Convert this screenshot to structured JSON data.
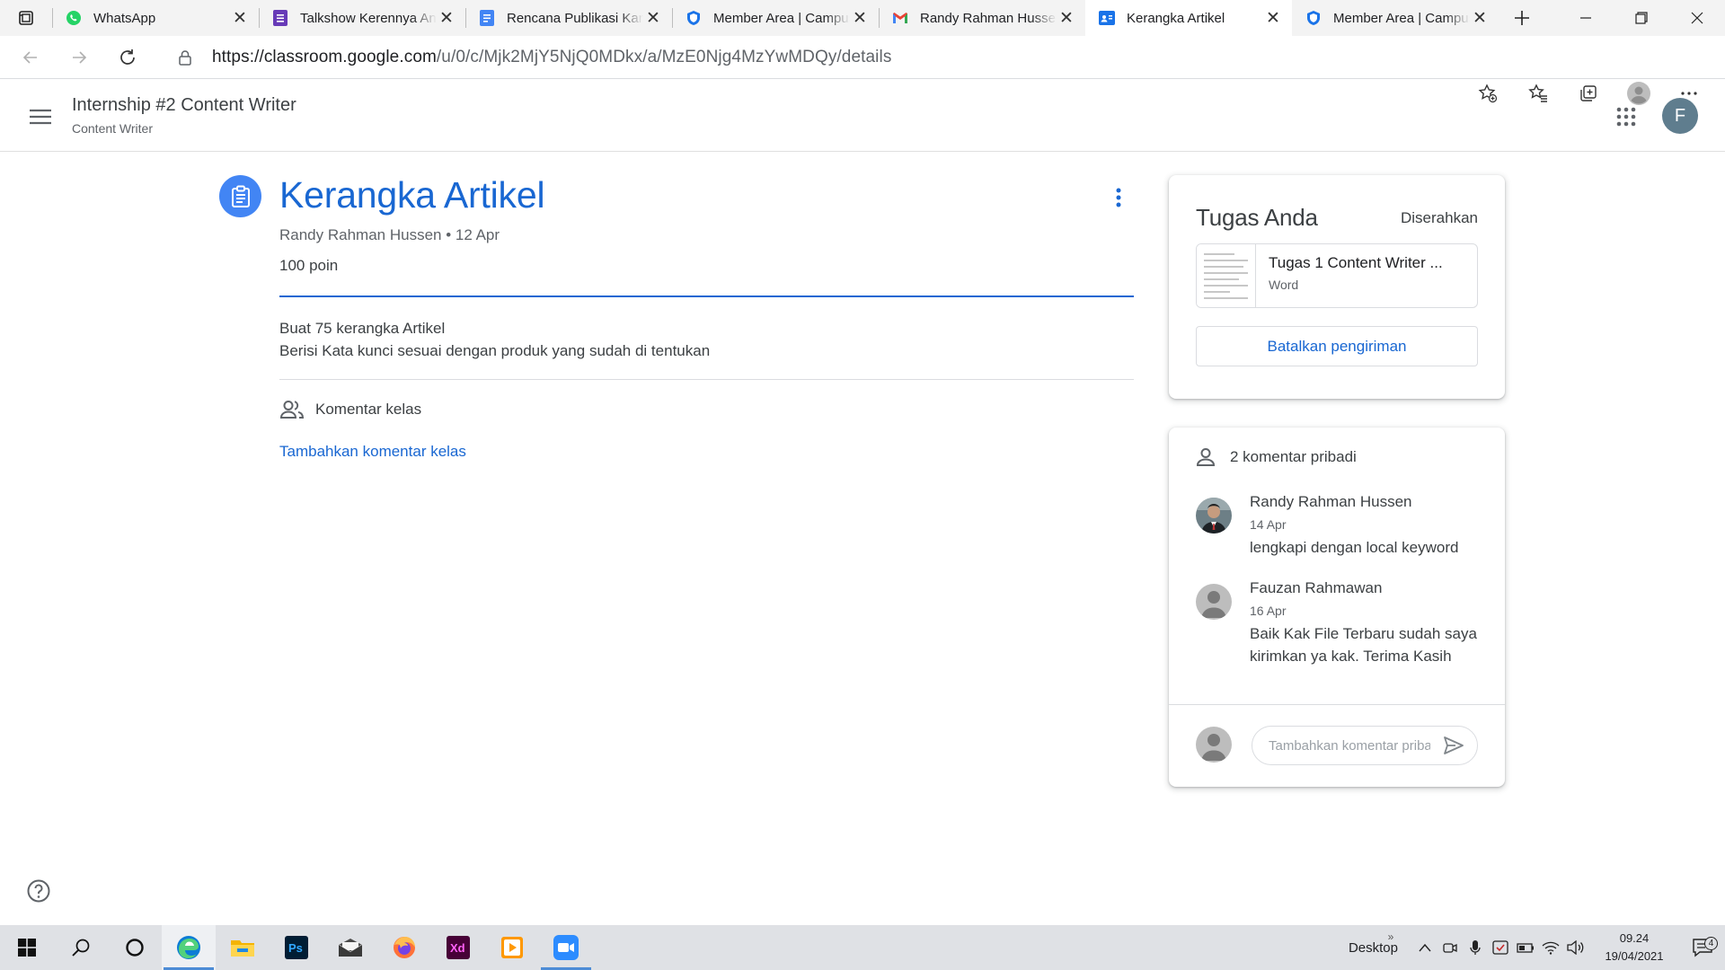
{
  "browser": {
    "tabs": [
      {
        "title": "WhatsApp",
        "icon": "whatsapp-icon",
        "active": false
      },
      {
        "title": "Talkshow Kerennya Anak",
        "icon": "google-forms-icon",
        "active": false
      },
      {
        "title": "Rencana Publikasi Kampus",
        "icon": "google-docs-icon",
        "active": false
      },
      {
        "title": "Member Area | Campus",
        "icon": "shield-icon",
        "active": false
      },
      {
        "title": "Randy Rahman Hussen",
        "icon": "gmail-icon",
        "active": false
      },
      {
        "title": "Kerangka Artikel",
        "icon": "classroom-icon",
        "active": true
      },
      {
        "title": "Member Area | Campus",
        "icon": "shield-icon",
        "active": false
      }
    ],
    "url_host": "https://classroom.google.com",
    "url_path": "/u/0/c/Mjk2MjY5NjQ0MDkx/a/MzE0Njg4MzYwMDQy/details"
  },
  "classroom": {
    "class_name": "Internship #2 Content Writer",
    "class_section": "Content Writer",
    "profile_initial": "F"
  },
  "assignment": {
    "title": "Kerangka Artikel",
    "meta": "Randy Rahman Hussen • 12 Apr",
    "points": "100 poin",
    "description_lines": [
      "Buat 75 kerangka Artikel",
      "Berisi Kata kunci sesuai dengan produk yang sudah di tentukan"
    ],
    "class_comments_label": "Komentar kelas",
    "add_class_comment": "Tambahkan komentar kelas"
  },
  "your_work": {
    "title": "Tugas Anda",
    "status": "Diserahkan",
    "attachment_name": "Tugas 1 Content Writer ...",
    "attachment_type": "Word",
    "unsubmit_label": "Batalkan pengiriman"
  },
  "private_comments": {
    "header": "2 komentar pribadi",
    "items": [
      {
        "author": "Randy Rahman Hussen",
        "date": "14 Apr",
        "text": "lengkapi dengan local keyword"
      },
      {
        "author": "Fauzan Rahmawan",
        "date": "16 Apr",
        "text": "Baik Kak File Terbaru sudah saya kirimkan ya kak. Terima Kasih"
      }
    ],
    "input_placeholder": "Tambahkan komentar pribadi"
  },
  "taskbar": {
    "desktop_label": "Desktop",
    "time": "09.24",
    "date": "19/04/2021",
    "notification_count": "4",
    "apps": [
      "edge-icon",
      "file-explorer-icon",
      "photoshop-icon",
      "mail-icon",
      "firefox-icon",
      "adobe-xd-icon",
      "media-player-icon",
      "zoom-icon"
    ]
  },
  "colors": {
    "accent_blue": "#1967d2",
    "assignment_icon_bg": "#4285f4",
    "avatar_bg": "#5f7d8e"
  }
}
